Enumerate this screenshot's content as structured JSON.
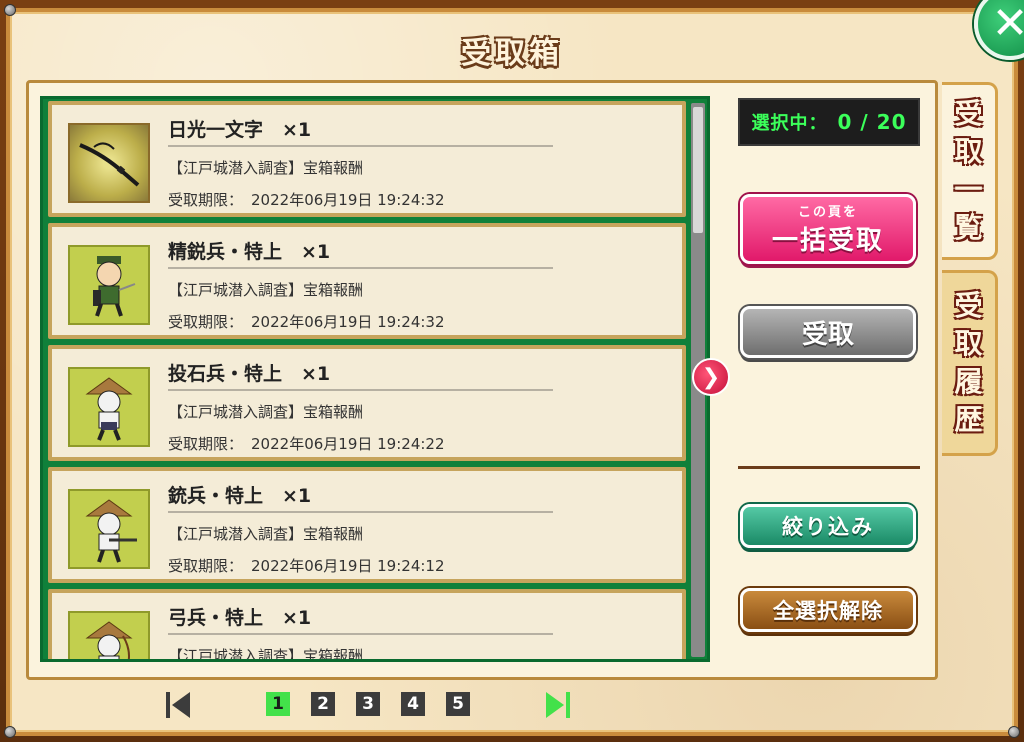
{
  "window": {
    "title": "受取箱",
    "close_label": "✕"
  },
  "items": [
    {
      "name": "日光一文字　×1",
      "source": "【江戸城潜入調査】宝箱報酬",
      "deadline_label": "受取期限：",
      "deadline": "2022年06月19日 19:24:32",
      "icon": "sword-icon"
    },
    {
      "name": "精鋭兵・特上　×1",
      "source": "【江戸城潜入調査】宝箱報酬",
      "deadline_label": "受取期限：",
      "deadline": "2022年06月19日 19:24:32",
      "icon": "elite-soldier-icon"
    },
    {
      "name": "投石兵・特上　×1",
      "source": "【江戸城潜入調査】宝箱報酬",
      "deadline_label": "受取期限：",
      "deadline": "2022年06月19日 19:24:22",
      "icon": "stone-thrower-icon"
    },
    {
      "name": "銃兵・特上　×1",
      "source": "【江戸城潜入調査】宝箱報酬",
      "deadline_label": "受取期限：",
      "deadline": "2022年06月19日 19:24:12",
      "icon": "gunner-icon"
    },
    {
      "name": "弓兵・特上　×1",
      "source": "【江戸城潜入調査】宝箱報酬",
      "deadline_label": "",
      "deadline": "",
      "icon": "archer-icon"
    }
  ],
  "selection": {
    "label": "選択中：",
    "value": "0 / 20"
  },
  "buttons": {
    "bulk_small": "この頁を",
    "bulk_big": "一括受取",
    "receive": "受取",
    "filter": "絞り込み",
    "clear": "全選択解除"
  },
  "tabs": {
    "list": [
      "受",
      "取",
      "一",
      "覧"
    ],
    "history": [
      "受",
      "取",
      "履",
      "歴"
    ]
  },
  "pagination": {
    "pages": [
      "1",
      "2",
      "3",
      "4",
      "5"
    ],
    "current": "1"
  },
  "colors": {
    "list_border": "#10803a",
    "bulk_button": "#e1196a",
    "filter_button": "#1a8a66",
    "clear_button": "#8a4f14",
    "active_page": "#43e14a",
    "selection_text": "#3bff5a"
  }
}
